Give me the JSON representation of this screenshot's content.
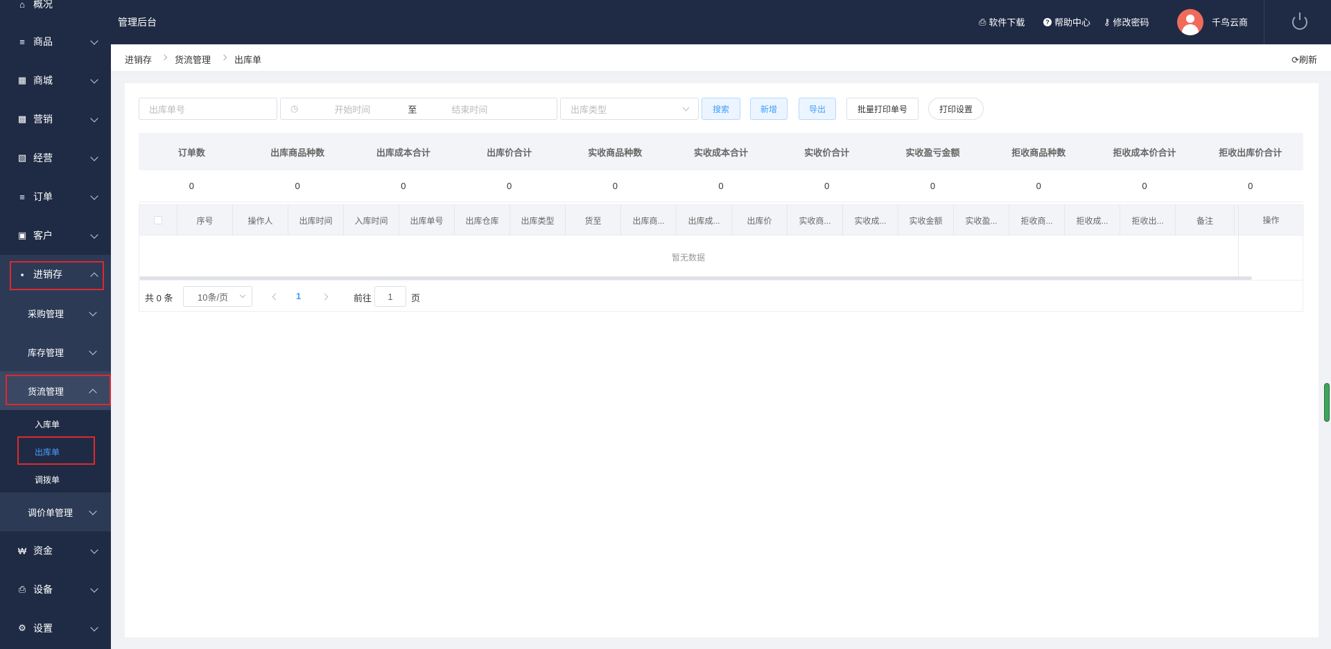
{
  "app": {
    "title": "管理后台"
  },
  "header": {
    "links": [
      {
        "label": "软件下载",
        "icon": "printer-icon"
      },
      {
        "label": "帮助中心",
        "icon": "help-icon"
      },
      {
        "label": "修改密码",
        "icon": "key-icon"
      }
    ],
    "user": {
      "name": "千鸟云商"
    }
  },
  "sidebar": {
    "top_item": {
      "label": "概况",
      "icon": "home-icon"
    },
    "items": [
      {
        "label": "商品",
        "icon": "list-icon"
      },
      {
        "label": "商城",
        "icon": "shop-bag-icon"
      },
      {
        "label": "营销",
        "icon": "gift-icon"
      },
      {
        "label": "经营",
        "icon": "bar-chart-icon"
      },
      {
        "label": "订单",
        "icon": "order-list-icon"
      },
      {
        "label": "客户",
        "icon": "id-card-icon"
      },
      {
        "label": "进销存",
        "icon": "truck-icon"
      }
    ],
    "sub_items": [
      {
        "label": "采购管理"
      },
      {
        "label": "库存管理"
      },
      {
        "label": "货流管理"
      }
    ],
    "leaves": [
      {
        "label": "入库单"
      },
      {
        "label": "出库单"
      },
      {
        "label": "调拨单"
      }
    ],
    "sub_after": {
      "label": "调价单管理"
    },
    "bottom_items": [
      {
        "label": "资金",
        "icon": "won-icon"
      },
      {
        "label": "设备",
        "icon": "printer-icon"
      },
      {
        "label": "设置",
        "icon": "gear-icon"
      }
    ]
  },
  "breadcrumb": [
    "进销存",
    "货流管理",
    "出库单"
  ],
  "refresh_label": "刷新",
  "filters": {
    "order_no_placeholder": "出库单号",
    "start_placeholder": "开始时间",
    "range_sep": "至",
    "end_placeholder": "结束时间",
    "type_placeholder": "出库类型"
  },
  "buttons": {
    "search": "搜索",
    "add": "新增",
    "export": "导出",
    "batch_print": "批量打印单号",
    "print_settings": "打印设置"
  },
  "summary": {
    "headers": [
      "订单数",
      "出库商品种数",
      "出库成本合计",
      "出库价合计",
      "实收商品种数",
      "实收成本合计",
      "实收价合计",
      "实收盈亏金额",
      "拒收商品种数",
      "拒收成本价合计",
      "拒收出库价合计"
    ],
    "values": [
      "0",
      "0",
      "0",
      "0",
      "0",
      "0",
      "0",
      "0",
      "0",
      "0",
      "0"
    ]
  },
  "table": {
    "columns": [
      "序号",
      "操作人",
      "出库时间",
      "入库时间",
      "出库单号",
      "出库仓库",
      "出库类型",
      "货至",
      "出库商...",
      "出库成...",
      "出库价",
      "实收商...",
      "实收成...",
      "实收金额",
      "实收盈...",
      "拒收商...",
      "拒收成...",
      "拒收出...",
      "备注"
    ],
    "op_column": "操作",
    "empty_text": "暂无数据"
  },
  "pager": {
    "total": "共 0 条",
    "page_size": "10条/页",
    "current_page": "1",
    "goto_label": "前往",
    "goto_value": "1",
    "page_unit": "页"
  }
}
